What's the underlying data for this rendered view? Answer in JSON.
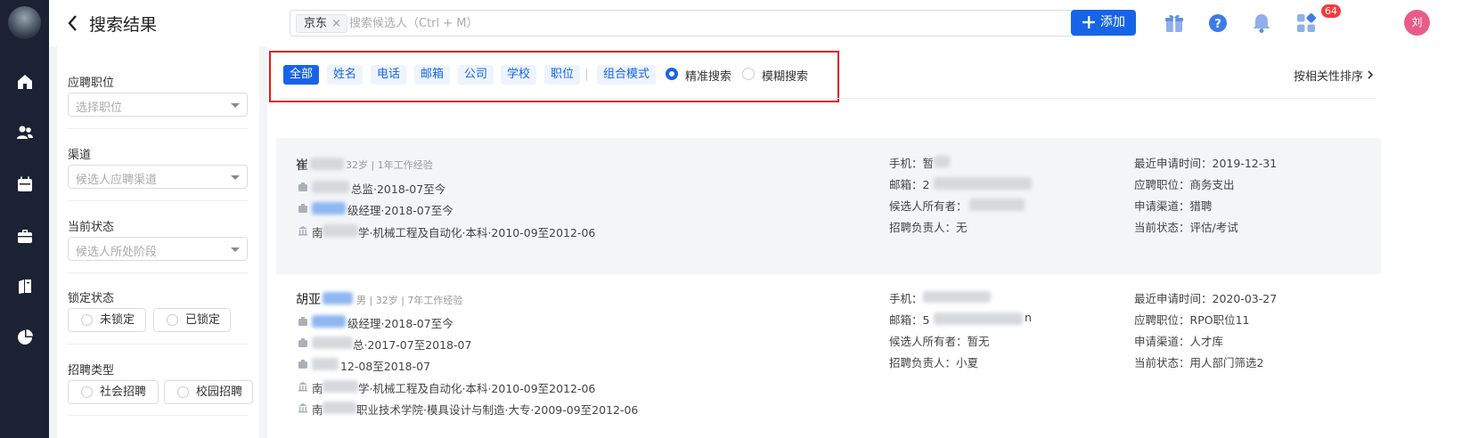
{
  "header": {
    "title": "搜索结果",
    "search_tag": "京东",
    "search_tag_close": "×",
    "search_placeholder": "搜索候选人（Ctrl + M）",
    "add_button": "添加",
    "notification_count": "64",
    "avatar_initial": "刘"
  },
  "rail": {
    "items": [
      "home-icon",
      "people-icon",
      "calendar-icon",
      "briefcase-icon",
      "book-icon",
      "pie-chart-icon"
    ]
  },
  "filters": {
    "position_label": "应聘职位",
    "position_placeholder": "选择职位",
    "channel_label": "渠道",
    "channel_placeholder": "候选人应聘渠道",
    "status_label": "当前状态",
    "status_placeholder": "候选人所处阶段",
    "lock_label": "锁定状态",
    "lock_options": [
      "未锁定",
      "已锁定"
    ],
    "recruit_type_label": "招聘类型",
    "recruit_type_options": [
      "社会招聘",
      "校园招聘"
    ]
  },
  "filterbar": {
    "chips": [
      "全部",
      "姓名",
      "电话",
      "邮箱",
      "公司",
      "学校",
      "职位"
    ],
    "combo_mode": "组合模式",
    "exact_search": "精准搜索",
    "fuzzy_search": "模糊搜索",
    "selected_mode": "精准搜索",
    "sort_label": "按相关性排序"
  },
  "candidates": [
    {
      "name": "崔",
      "meta": "32岁 | 1年工作经验",
      "experience": [
        "总监·2018-07至今",
        "级经理·2018-07至今"
      ],
      "education": "学·机械工程及自动化·本科·2010-09至2012-06",
      "phone_label": "手机：",
      "phone": "暂",
      "email_label": "邮箱：",
      "email": "2",
      "owner_label": "候选人所有者：",
      "owner": "",
      "recruiter_label": "招聘负责人：",
      "recruiter": "无",
      "recent_label": "最近申请时间：",
      "recent": "2019-12-31",
      "applied_label": "应聘职位：",
      "applied": "商务支出",
      "channel_label": "申请渠道：",
      "channel": "猎聘",
      "status_label": "当前状态：",
      "status": "评估/考试"
    },
    {
      "name": "胡亚",
      "meta": "男 | 32岁 | 7年工作经验",
      "experience": [
        "级经理·2018-07至今",
        "总·2017-07至2018-07",
        "12-08至2018-07"
      ],
      "education": [
        "学·机械工程及自动化·本科·2010-09至2012-06",
        "职业技术学院·模具设计与制造·大专·2009-09至2012-06"
      ],
      "education_prefix": [
        "南",
        "南"
      ],
      "phone_label": "手机：",
      "phone": "",
      "email_label": "邮箱：",
      "email": "5",
      "email_tail": "n",
      "owner_label": "候选人所有者：",
      "owner": "暂无",
      "recruiter_label": "招聘负责人：",
      "recruiter": "小夏",
      "recent_label": "最近申请时间：",
      "recent": "2020-03-27",
      "applied_label": "应聘职位：",
      "applied": "RPO职位11",
      "channel_label": "申请渠道：",
      "channel": "人才库",
      "status_label": "当前状态：",
      "status": "用人部门筛选2"
    }
  ],
  "colors": {
    "primary": "#1764e8",
    "rail": "#1a2233",
    "highlight_box": "#e31b1b",
    "badge": "#f03c3c",
    "avatar": "#e85d88"
  }
}
